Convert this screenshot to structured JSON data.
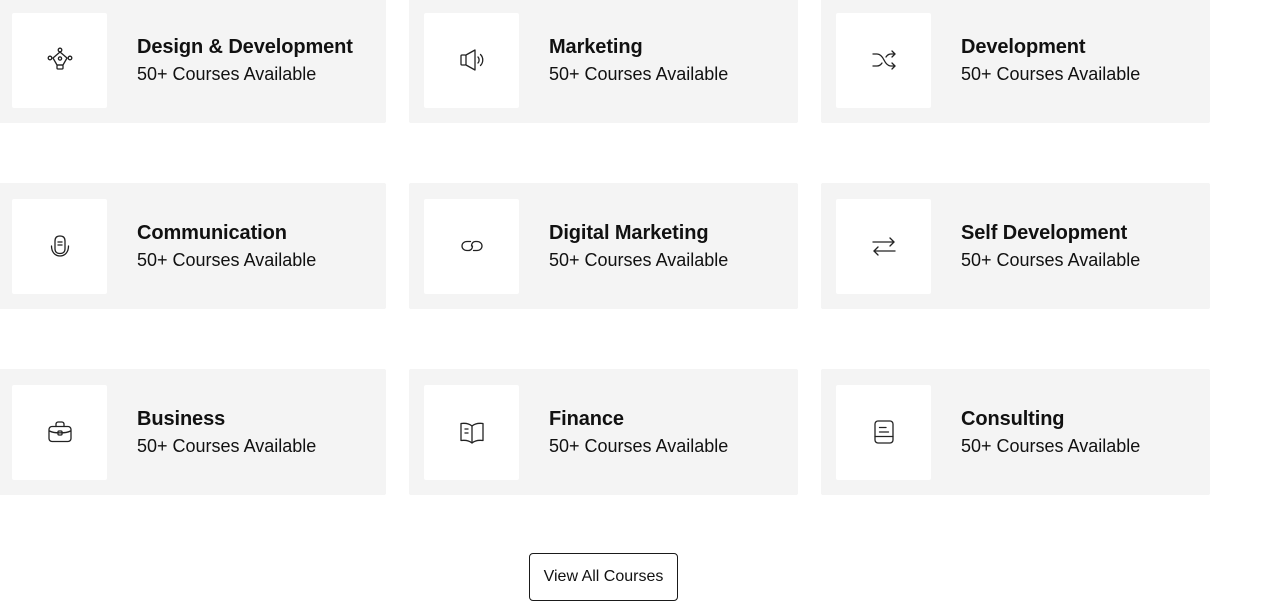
{
  "categories": [
    {
      "title": "Design & Development",
      "subtitle": "50+ Courses Available",
      "icon": "pen-tool-icon"
    },
    {
      "title": "Marketing",
      "subtitle": "50+ Courses Available",
      "icon": "megaphone-icon"
    },
    {
      "title": "Development",
      "subtitle": "50+ Courses Available",
      "icon": "shuffle-icon"
    },
    {
      "title": "Communication",
      "subtitle": "50+ Courses Available",
      "icon": "microphone-icon"
    },
    {
      "title": "Digital Marketing",
      "subtitle": "50+ Courses Available",
      "icon": "link-icon"
    },
    {
      "title": "Self Development",
      "subtitle": "50+ Courses Available",
      "icon": "arrows-exchange-icon"
    },
    {
      "title": "Business",
      "subtitle": "50+ Courses Available",
      "icon": "briefcase-icon"
    },
    {
      "title": "Finance",
      "subtitle": "50+ Courses Available",
      "icon": "open-book-icon"
    },
    {
      "title": "Consulting",
      "subtitle": "50+ Courses Available",
      "icon": "document-icon"
    }
  ],
  "view_all_button": {
    "label": "View All Courses"
  },
  "colors": {
    "card_background": "#f4f4f4",
    "icon_box_background": "#ffffff",
    "text": "#111111",
    "icon_stroke": "#222222"
  }
}
